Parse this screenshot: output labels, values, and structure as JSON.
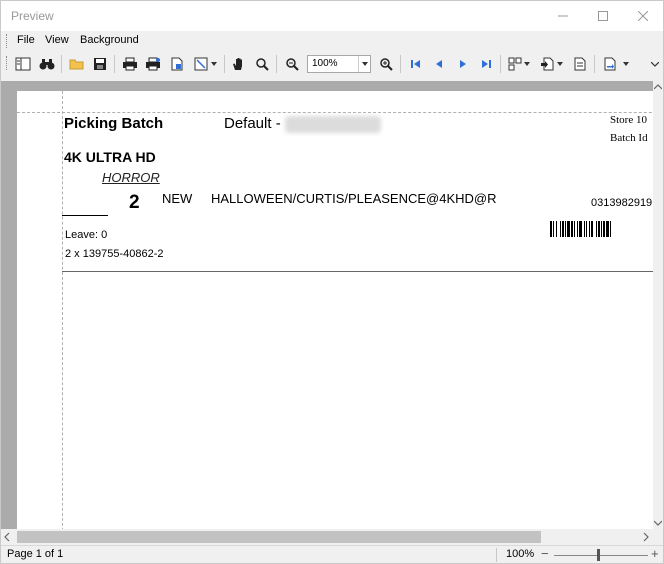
{
  "window": {
    "title": "Preview"
  },
  "menu": {
    "items": [
      "File",
      "View",
      "Background"
    ]
  },
  "toolbar": {
    "zoom_value": "100%",
    "icons": [
      "layout-icon",
      "binoculars-icon",
      "open-folder-icon",
      "save-icon",
      "print-icon",
      "quick-print-icon",
      "page-setup-icon",
      "scale-icon",
      "hand-tool-icon",
      "magnifier-icon",
      "zoom-out-icon",
      "zoom-in-icon",
      "first-page-icon",
      "previous-page-icon",
      "next-page-icon",
      "last-page-icon",
      "multiple-pages-icon",
      "export-icon",
      "single-page-icon",
      "send-icon"
    ]
  },
  "document": {
    "title": "Picking Batch",
    "default_label": "Default -",
    "store": "Store 10",
    "batch_id": "Batch Id",
    "format": "4K ULTRA HD",
    "genre": "HORROR",
    "quantity": "2",
    "condition": "NEW",
    "item": "HALLOWEEN/CURTIS/PLEASENCE@4KHD@R",
    "code": "0313982919",
    "leave": "Leave: 0",
    "pick_line": "2 x 139755-40862-2"
  },
  "status": {
    "page": "Page 1 of 1",
    "zoom": "100%",
    "zoom_fraction": 0.47
  }
}
